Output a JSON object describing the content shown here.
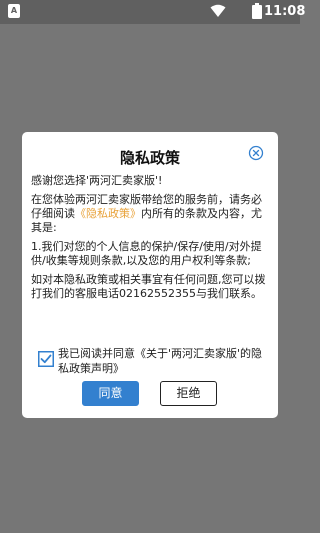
{
  "status_bar": {
    "app_icon_letter": "A",
    "time": "11:08",
    "icons": [
      "wifi-icon",
      "battery-icon"
    ]
  },
  "dialog": {
    "title": "隐私政策",
    "greeting": "感谢您选择'两河汇卖家版'!",
    "intro_before_link": "在您体验两河汇卖家版带给您的服务前，请务必仔细阅读",
    "policy_link": "《隐私政策》",
    "intro_after_link": "内所有的条款及内容，尤其是:",
    "point_1": "1.我们对您的个人信息的保护/保存/使用/对外提供/收集等规则条款,以及您的用户权利等条款;",
    "contact": "如对本隐私政策或相关事宜有任何问题,您可以拨打我们的客服电话02162552355与我们联系。",
    "agreement": "我已阅读并同意《关于'两河汇卖家版'的隐私政策声明》",
    "agree_checked": true,
    "agree_button": "同意",
    "reject_button": "拒绝"
  },
  "colors": {
    "accent": "#3380cf",
    "link": "#e8a23a",
    "overlay": "#767676",
    "status_bar": "#606060"
  }
}
